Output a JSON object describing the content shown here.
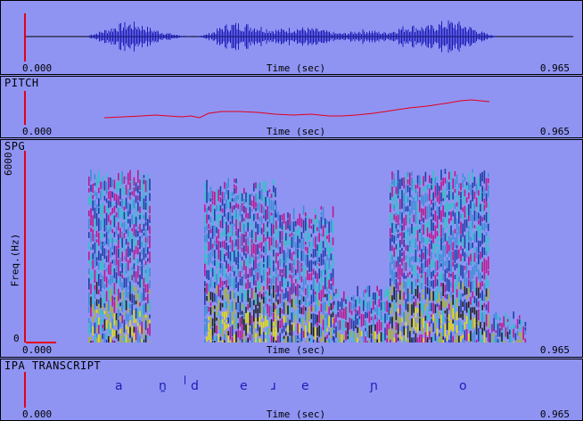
{
  "panels": {
    "waveform": {
      "title": "",
      "time_start": "0.000",
      "time_label": "Time (sec)",
      "time_end": "0.965"
    },
    "pitch": {
      "title": "PITCH",
      "time_start": "0.000",
      "time_label": "Time (sec)",
      "time_end": "0.965"
    },
    "spg": {
      "title": "SPG",
      "y_label": "Freq.(Hz)",
      "y_top": "6000",
      "y_bottom": "0",
      "time_start": "0.000",
      "time_label": "Time (sec)",
      "time_end": "0.965"
    },
    "ipa": {
      "title": "IPA TRANSCRIPT",
      "segments": [
        "a",
        "n̪",
        "d",
        "e",
        "ɹ",
        "e",
        "ɲ",
        "o"
      ],
      "time_start": "0.000",
      "time_label": "Time (sec)",
      "time_end": "0.965"
    }
  },
  "colors": {
    "background": "#8f94f3",
    "waveform": "#1d1db8",
    "pitch": "#e3001b",
    "accent": "#e3001b"
  }
}
